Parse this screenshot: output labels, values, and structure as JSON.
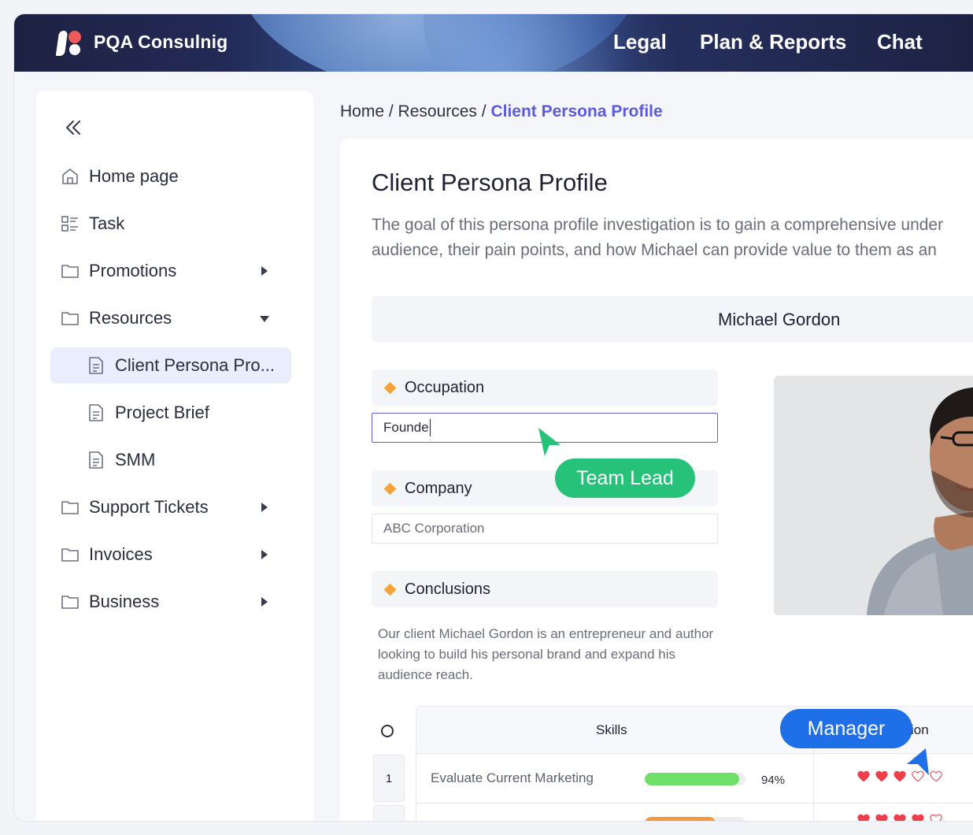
{
  "header": {
    "brand": "PQA Consulnig",
    "nav": [
      "Legal",
      "Plan & Reports",
      "Chat"
    ]
  },
  "sidebar": {
    "items": [
      {
        "label": "Home page",
        "icon": "home-icon"
      },
      {
        "label": "Task",
        "icon": "task-list-icon"
      },
      {
        "label": "Promotions",
        "icon": "folder-icon"
      },
      {
        "label": "Resources",
        "icon": "folder-icon"
      },
      {
        "label": "Client Persona Pro...",
        "icon": "document-icon"
      },
      {
        "label": "Project Brief",
        "icon": "document-icon"
      },
      {
        "label": "SMM",
        "icon": "document-icon"
      },
      {
        "label": "Support Tickets",
        "icon": "folder-icon"
      },
      {
        "label": "Invoices",
        "icon": "folder-icon"
      },
      {
        "label": "Business",
        "icon": "folder-icon"
      }
    ]
  },
  "breadcrumb": {
    "home": "Home",
    "sep": " / ",
    "section": "Resources",
    "current": "Client Persona Profile"
  },
  "page": {
    "title": "Client Persona Profile",
    "intro_line1": "The goal of this persona profile investigation is to gain a comprehensive under",
    "intro_line2": "audience, their pain points, and how Michael can provide value to them as an",
    "name": "Michael Gordon",
    "occupation_label": "Occupation",
    "occupation_value": "Founde",
    "company_label": "Company",
    "company_value": "ABC Corporation",
    "conclusions_label": "Conclusions",
    "conclusions_text": "Our client Michael Gordon is an entrepreneur and author looking to build his personal brand and expand his audience reach."
  },
  "table": {
    "skills_header": "Skills",
    "passion_header": "ion",
    "rows": [
      {
        "num": "1",
        "skill": "Evaluate Current Marketing",
        "percent": "94%",
        "progress": 0.94,
        "bar_color": "#6ee06a",
        "hearts_filled": 3,
        "hearts_total": 5
      },
      {
        "num": "",
        "skill": "",
        "percent": "",
        "progress": 0.7,
        "bar_color": "#f39a3a",
        "hearts_filled": 4,
        "hearts_total": 5
      }
    ]
  },
  "collaborators": {
    "green_tag": "Team Lead",
    "blue_tag": "Manager",
    "green_color": "#27c27a",
    "blue_color": "#1f6fe8"
  },
  "colors": {
    "accent": "#5b5bdc",
    "diamond": "#f3a338",
    "heart": "#ef3f4b"
  }
}
